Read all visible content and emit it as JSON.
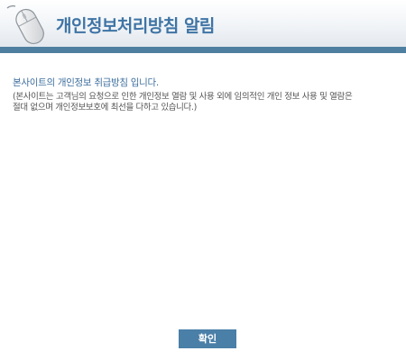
{
  "header": {
    "title": "개인정보처리방침 알림",
    "icon": "computer-mouse-icon",
    "accent_color": "#4f7fa0",
    "title_color": "#3f74a5"
  },
  "notice": {
    "heading": "본사이트의 개인정보 취급방침 입니다.",
    "line1": "(본사이트는 고객님의 요청으로 인한 개인정보 열람 및 사용 외에 임의적인 개인 정보 사용 및 열람은",
    "line2": "절대 없으며 개인정보보호에 최선을 다하고 있습니다.)"
  },
  "footer": {
    "confirm_label": "확인",
    "button_color": "#4a7fa8"
  }
}
